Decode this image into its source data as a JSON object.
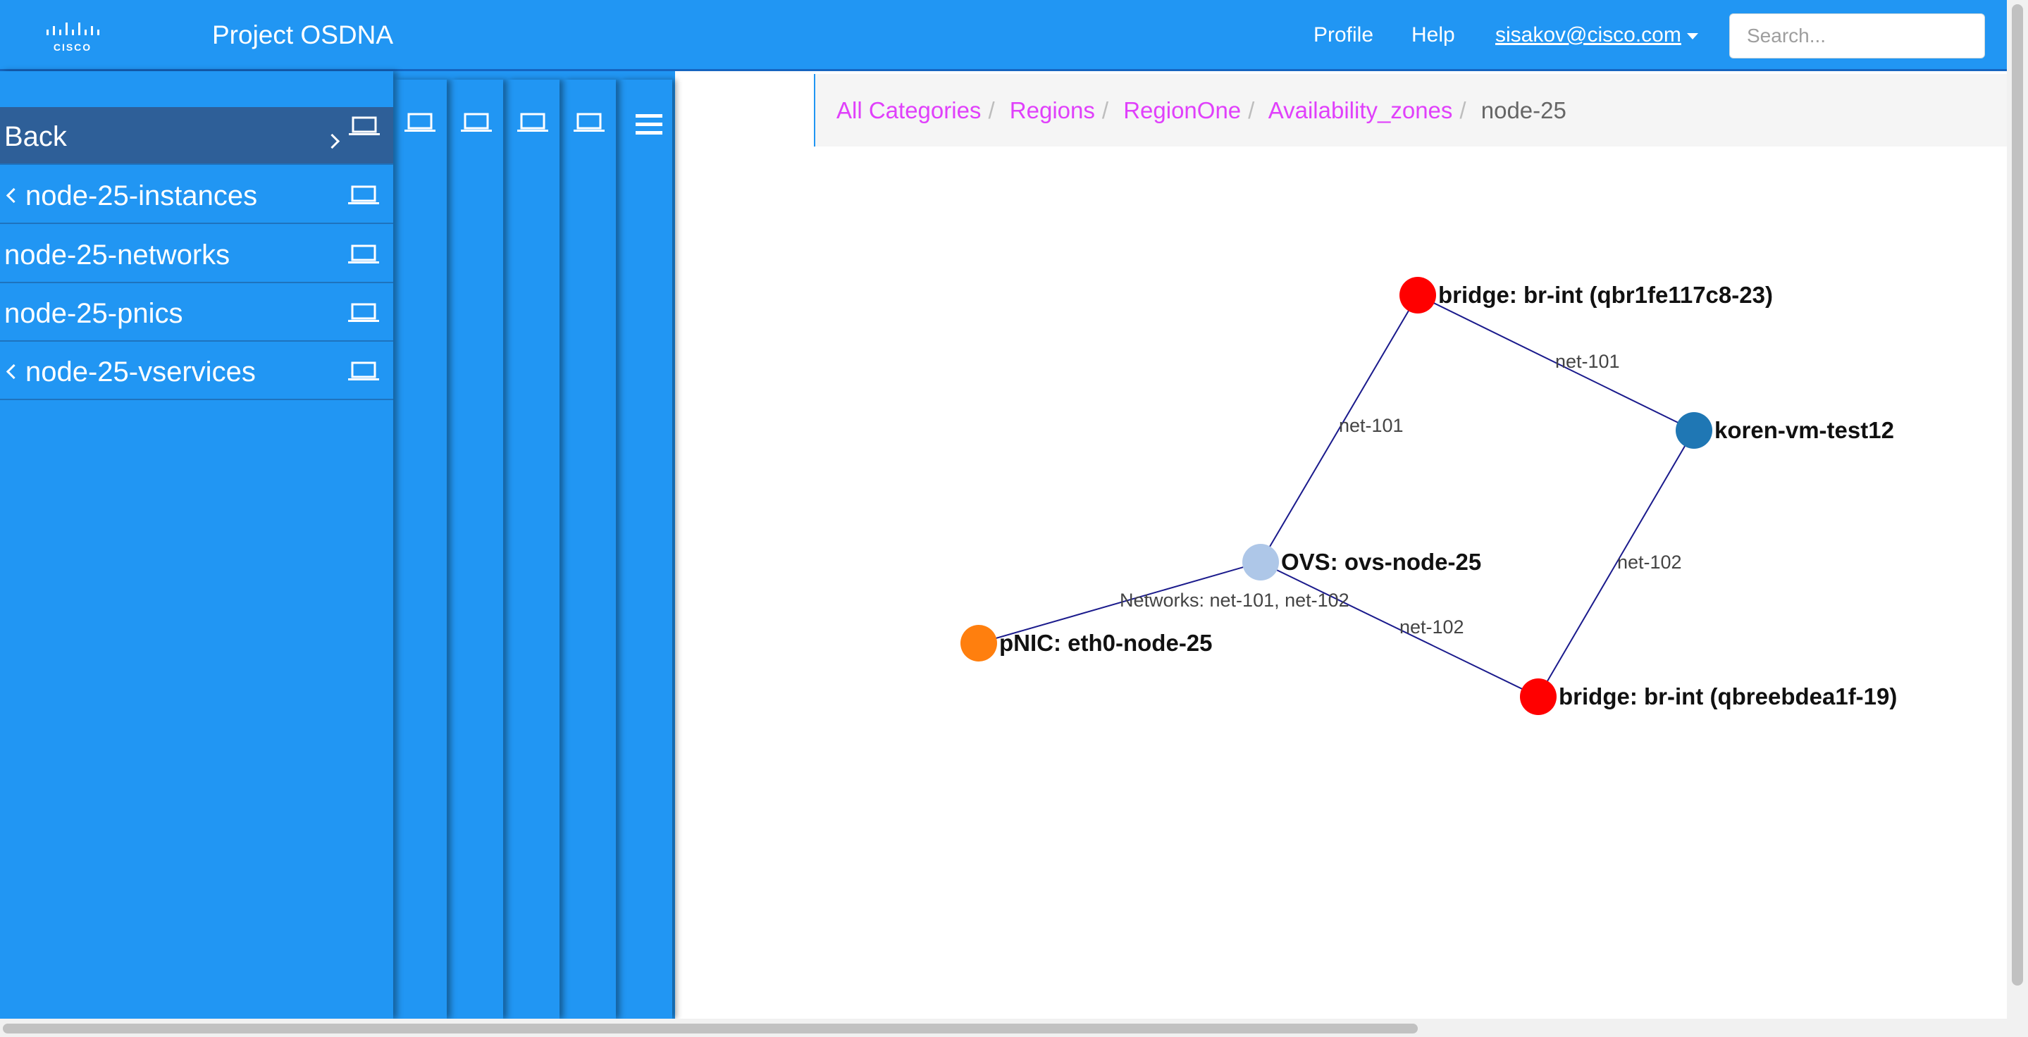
{
  "navbar": {
    "brand": "Project OSDNA",
    "logo_icon": "cisco-logo-icon",
    "profile_label": "Profile",
    "help_label": "Help",
    "user_email": "sisakov@cisco.com",
    "search_placeholder": "Search..."
  },
  "sidebar": {
    "back_label": "Back",
    "items": [
      {
        "label": "node-25-instances",
        "collapsible": true
      },
      {
        "label": "node-25-networks",
        "collapsible": false
      },
      {
        "label": "node-25-pnics",
        "collapsible": false
      },
      {
        "label": "node-25-vservices",
        "collapsible": true
      }
    ],
    "column_icons": [
      "laptop-icon",
      "laptop-icon",
      "laptop-icon",
      "laptop-icon",
      "hamburger-menu-icon"
    ]
  },
  "breadcrumb": {
    "items": [
      "All Categories",
      "Regions",
      "RegionOne",
      "Availability_zones"
    ],
    "active": "node-25"
  },
  "graph": {
    "nodes": [
      {
        "id": "bridge1",
        "label": "bridge: br-int (qbr1fe117c8-23)",
        "color": "#ff0000"
      },
      {
        "id": "vm",
        "label": "koren-vm-test12",
        "color": "#1f77b4"
      },
      {
        "id": "ovs",
        "label": "OVS: ovs-node-25",
        "color": "#aec7e8"
      },
      {
        "id": "pnic",
        "label": "pNIC: eth0-node-25",
        "color": "#ff7f0e"
      },
      {
        "id": "bridge2",
        "label": "bridge: br-int (qbreebdea1f-19)",
        "color": "#ff0000"
      }
    ],
    "edges": [
      {
        "source": "bridge1",
        "target": "vm",
        "label": "net-101"
      },
      {
        "source": "ovs",
        "target": "bridge1",
        "label": "net-101"
      },
      {
        "source": "vm",
        "target": "bridge2",
        "label": "net-102"
      },
      {
        "source": "ovs",
        "target": "bridge2",
        "label": "net-102"
      },
      {
        "source": "pnic",
        "target": "ovs",
        "label": "Networks: net-101, net-102"
      }
    ]
  },
  "colors": {
    "primary": "#2196f3",
    "back_item": "#2e5f98",
    "breadcrumb_link": "#e040fb",
    "edge": "#1a1a8c"
  }
}
